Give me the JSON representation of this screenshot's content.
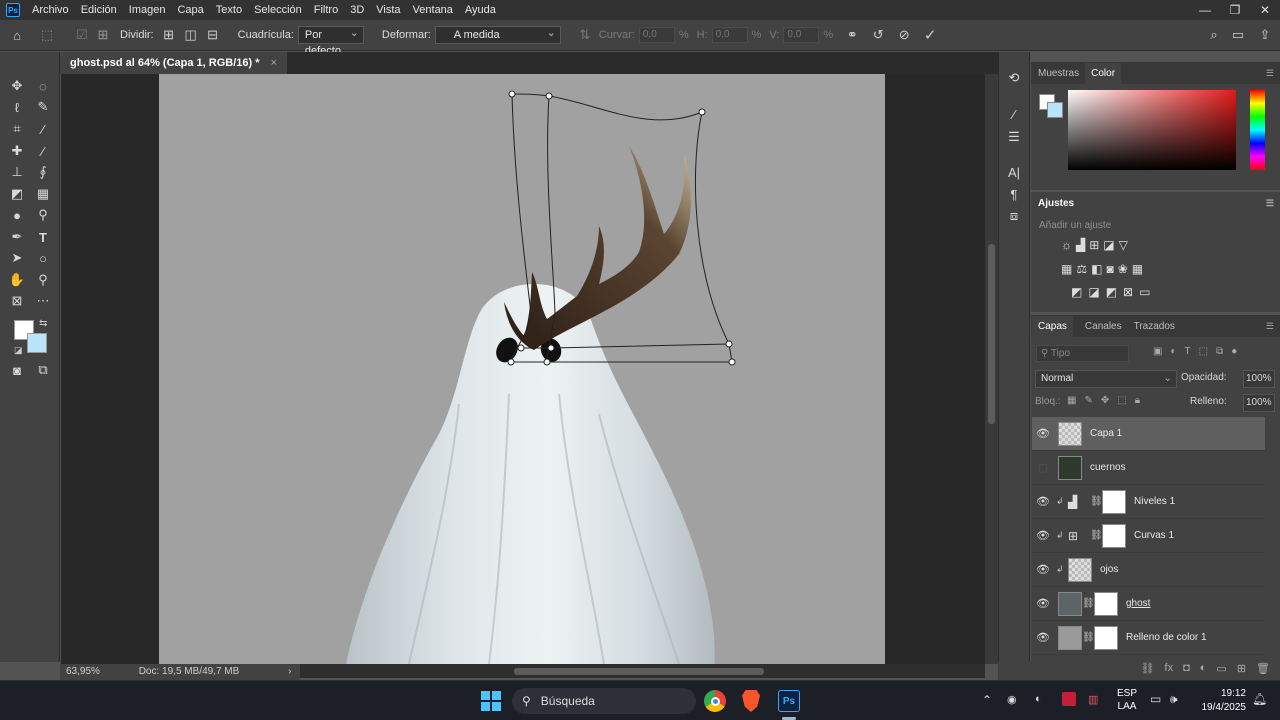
{
  "menubar": {
    "logo": "Ps",
    "items": [
      "Archivo",
      "Edición",
      "Imagen",
      "Capa",
      "Texto",
      "Selección",
      "Filtro",
      "3D",
      "Vista",
      "Ventana",
      "Ayuda"
    ]
  },
  "options": {
    "dividir_label": "Dividir:",
    "cuadricula_label": "Cuadrícula:",
    "cuadricula_value": "Por defecto",
    "deformar_label": "Deformar:",
    "deformar_value": "A medida",
    "curvar_label": "Curvar:",
    "curvar_value": "0,0",
    "h_label": "H:",
    "h_value": "0,0",
    "v_label": "V:",
    "v_value": "0,0",
    "percent": "%"
  },
  "document": {
    "tab_title": "ghost.psd al 64% (Capa 1, RGB/16) *",
    "close": "×"
  },
  "status": {
    "zoom": "63,95%",
    "doc": "Doc: 19,5 MB/49,7 MB"
  },
  "panels": {
    "swatches_tab": "Muestras",
    "color_tab": "Color",
    "ajustes_title": "Ajustes",
    "ajustes_hint": "Añadir un ajuste",
    "layers_tabs": [
      "Capas",
      "Canales",
      "Trazados"
    ],
    "search_placeholder": "Tipo",
    "blend_mode": "Normal",
    "opacity_label": "Opacidad:",
    "opacity_value": "100%",
    "lock_label": "Bloq.:",
    "fill_label": "Relleno:",
    "fill_value": "100%"
  },
  "layers": [
    {
      "name": "Capa 1",
      "visible": true,
      "selected": true
    },
    {
      "name": "cuernos",
      "visible": false,
      "selected": false
    },
    {
      "name": "Niveles 1",
      "visible": true,
      "selected": false
    },
    {
      "name": "Curvas 1",
      "visible": true,
      "selected": false
    },
    {
      "name": "ojos",
      "visible": true,
      "selected": false
    },
    {
      "name": "ghost",
      "visible": true,
      "selected": false
    },
    {
      "name": "Relleno de color 1",
      "visible": true,
      "selected": false
    }
  ],
  "taskbar": {
    "search_label": "Búsqueda",
    "lang_1": "ESP",
    "lang_2": "LAA",
    "time": "19:12",
    "date": "19/4/2025"
  },
  "colors": {
    "fg": "#ffffff",
    "bg": "#b9e5fb",
    "accent": "#31a8ff"
  }
}
